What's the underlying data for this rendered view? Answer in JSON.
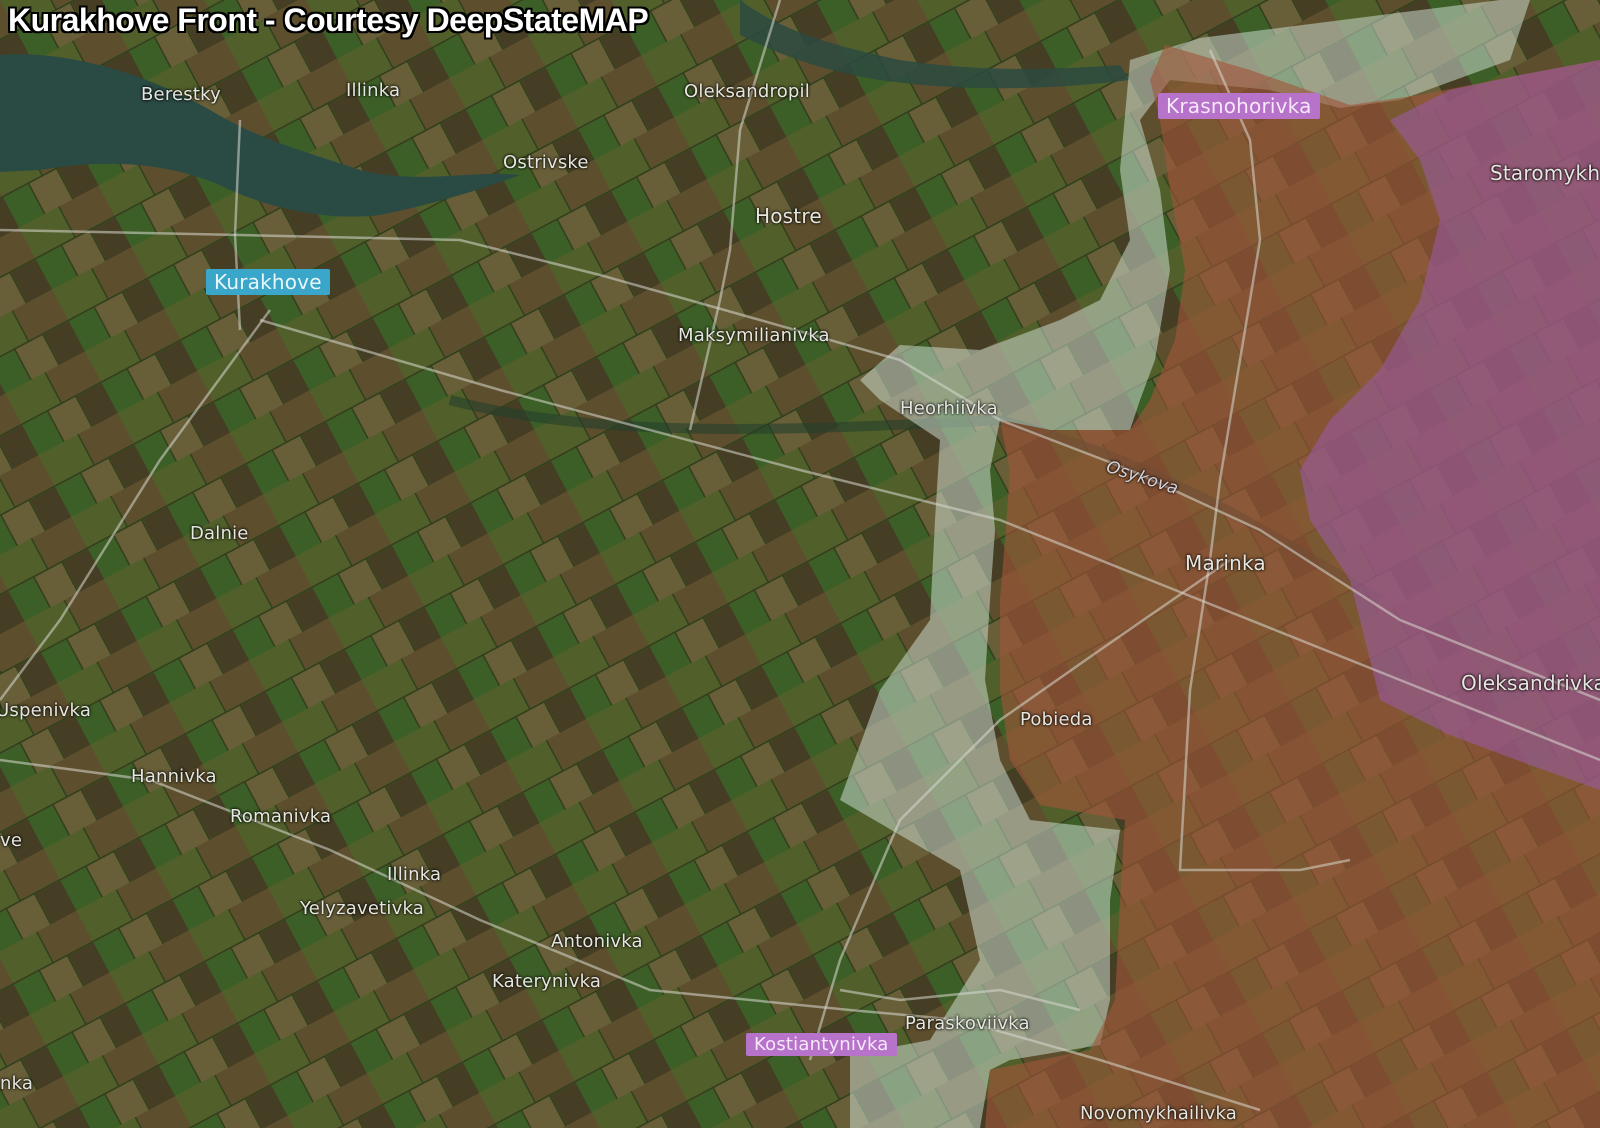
{
  "title": "Kurakhove Front - Courtesy DeepStateMAP",
  "colors": {
    "occupied_zone": "#a2553a",
    "pre_war_occupied": "#9b5bab",
    "contested_zone": "#c8d8cc",
    "highlight_blue": "#3aa6c9",
    "highlight_purple": "#b772c9"
  },
  "places": {
    "berestky": "Berestky",
    "illinka_north": "Illinka",
    "oleksandropil": "Oleksandropil",
    "ostrivske": "Ostrivske",
    "hostre": "Hostre",
    "kurakhove": "Kurakhove",
    "krasnohorivka": "Krasnohorivka",
    "staromykh": "Staromykh",
    "maksymilianivka": "Maksymilianivka",
    "heorhiivka": "Heorhiivka",
    "osykova": "Osykova",
    "marinka": "Marinka",
    "dalnie": "Dalnie",
    "uspenivka": "Uspenivka",
    "hannivka": "Hannivka",
    "romanivka": "Romanivka",
    "ve": "ve",
    "illinka_south": "Illinka",
    "yelyzavetivka": "Yelyzavetivka",
    "antonivka": "Antonivka",
    "katerynivka": "Katerynivka",
    "paraskoviivka": "Paraskoviivka",
    "kostiantynivka": "Kostiantynivka",
    "nka": "nka",
    "novomykhailivka": "Novomykhailivka",
    "pobieda": "Pobieda",
    "oleksandrivka": "Oleksandrivka"
  }
}
